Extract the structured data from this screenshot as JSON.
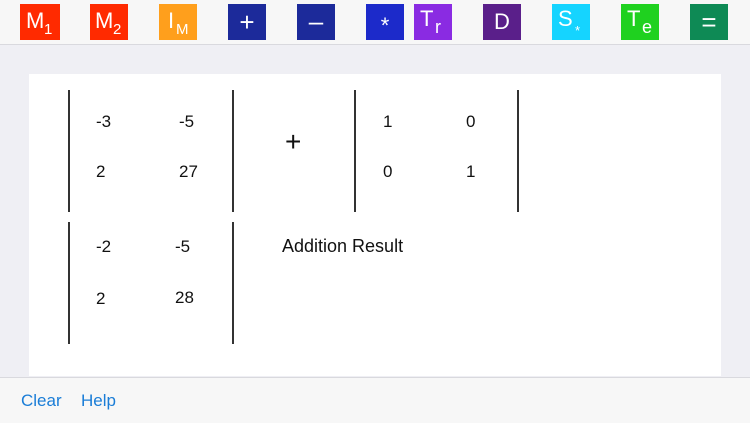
{
  "toolbar": {
    "m1": {
      "main": "M",
      "sub": "1",
      "color": "#ff2a00"
    },
    "m2": {
      "main": "M",
      "sub": "2",
      "color": "#ff2a00"
    },
    "im": {
      "main": "I",
      "sub": "M",
      "color": "#ff9f1c"
    },
    "add": {
      "label": "+",
      "color": "#1c2a9a"
    },
    "subtract": {
      "label": "–",
      "color": "#1c2a9a"
    },
    "multiply": {
      "label": "*",
      "color": "#1c2aca"
    },
    "transpose": {
      "main": "T",
      "sub": "r",
      "color": "#8a2be2"
    },
    "determinant": {
      "label": "D",
      "color": "#5a1f8a"
    },
    "scalar": {
      "main": "S",
      "sub": "*",
      "color": "#15d4ff"
    },
    "te": {
      "main": "T",
      "sub": "e",
      "color": "#1fd11f"
    },
    "equals": {
      "label": "=",
      "color": "#0e8a55"
    }
  },
  "workspace": {
    "matrix_a": {
      "row1": [
        "-3",
        "-5"
      ],
      "row2": [
        "2",
        "27"
      ]
    },
    "operator": "+",
    "matrix_b": {
      "row1": [
        "1",
        "0"
      ],
      "row2": [
        "0",
        "1"
      ]
    },
    "result": {
      "row1": [
        "-2",
        "-5"
      ],
      "row2": [
        "2",
        "28"
      ]
    },
    "result_label": "Addition Result"
  },
  "bottombar": {
    "clear_label": "Clear",
    "help_label": "Help"
  }
}
